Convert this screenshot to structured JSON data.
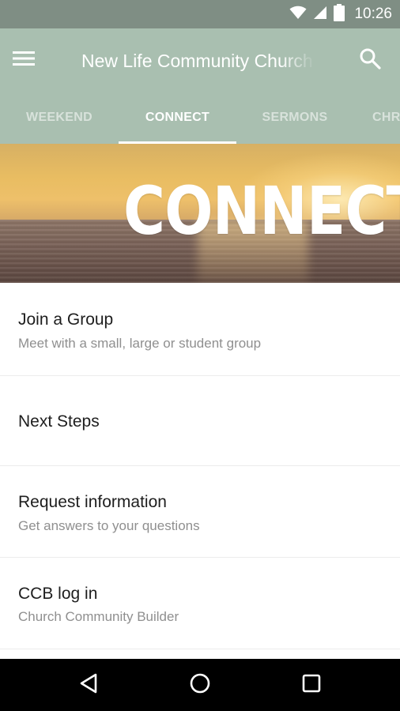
{
  "status_bar": {
    "time": "10:26",
    "icons": [
      "wifi-icon",
      "signal-icon",
      "battery-icon"
    ]
  },
  "app_bar": {
    "title": "New Life Community Church",
    "menu_icon": "menu-icon",
    "search_icon": "search-icon",
    "background_color": "#a9bfb0"
  },
  "tabs": [
    {
      "label": "WEEKEND",
      "active": false
    },
    {
      "label": "CONNECT",
      "active": true
    },
    {
      "label": "SERMONS",
      "active": false
    },
    {
      "label": "CHR",
      "active": false
    }
  ],
  "hero": {
    "title": "CONNECT"
  },
  "list": [
    {
      "title": "Join a Group",
      "subtitle": "Meet with a small, large or student group"
    },
    {
      "title": "Next Steps",
      "subtitle": ""
    },
    {
      "title": "Request information",
      "subtitle": "Get answers to your questions"
    },
    {
      "title": "CCB log in",
      "subtitle": "Church Community Builder"
    }
  ],
  "nav_bar": {
    "icons": [
      "back-icon",
      "home-icon",
      "recents-icon"
    ]
  }
}
